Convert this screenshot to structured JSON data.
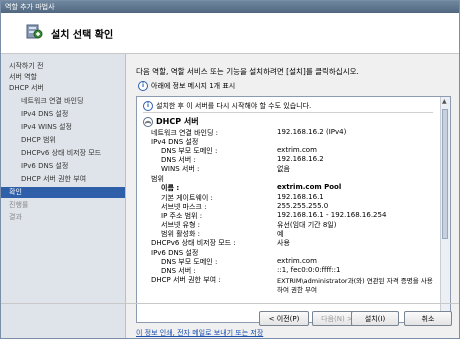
{
  "window": {
    "title": "역할 추가 마법사"
  },
  "header": {
    "title": "설치 선택 확인"
  },
  "sidebar": {
    "items": [
      {
        "label": "시작하기 전"
      },
      {
        "label": "서버 역할"
      },
      {
        "label": "DHCP 서버"
      },
      {
        "label": "네트워크 연결 바인딩"
      },
      {
        "label": "IPv4 DNS 설정"
      },
      {
        "label": "IPv4 WINS 설정"
      },
      {
        "label": "DHCP 범위"
      },
      {
        "label": "DHCPv6 상태 비저장 모드"
      },
      {
        "label": "IPv6 DNS 설정"
      },
      {
        "label": "DHCP 서버 권한 부여"
      },
      {
        "label": "확인"
      },
      {
        "label": "진행률"
      },
      {
        "label": "결과"
      }
    ]
  },
  "main": {
    "intro": "다음 역할, 역할 서비스 또는 기능을 설치하려면 [설치]를 클릭하십시오.",
    "info_link": "아래에 정보 메시지 1개 표시",
    "warning": "설치한 후 이 서버를 다시 시작해야 할 수도 있습니다.",
    "section_title": "DHCP 서버",
    "rows": [
      {
        "label": "네트워크 연결 바인딩 :",
        "value": "192.168.16.2 (IPv4)"
      },
      {
        "label": "IPv4 DNS 설정",
        "value": ""
      },
      {
        "label": "DNS 부모 도메인 :",
        "value": "extrim.com"
      },
      {
        "label": "DNS 서버 :",
        "value": "192.168.16.2"
      },
      {
        "label": "WINS 서버 :",
        "value": "없음"
      },
      {
        "label": "범위",
        "value": ""
      },
      {
        "label": "이름 :",
        "value": "extrim.com Pool"
      },
      {
        "label": "기본 게이트웨이 :",
        "value": "192.168.16.1"
      },
      {
        "label": "서브넷 마스크 :",
        "value": "255.255.255.0"
      },
      {
        "label": "IP 주소 범위 :",
        "value": "192.168.16.1 - 192.168.16.254"
      },
      {
        "label": "서브넷 유형 :",
        "value": "유선(임대 기간 8일)"
      },
      {
        "label": "범위 활성화 :",
        "value": "예"
      },
      {
        "label": "DHCPv6 상태 비저장 모드 :",
        "value": "사용"
      },
      {
        "label": "IPv6 DNS 설정",
        "value": ""
      },
      {
        "label": "DNS 부모 도메인 :",
        "value": "extrim.com"
      },
      {
        "label": "DNS 서버 :",
        "value": "::1, fec0:0:0:ffff::1"
      },
      {
        "label": "DHCP 서버 권한 부여 :",
        "value": "EXTRIM\\administrator과(와) 연관된 자격 증명을 사용"
      },
      {
        "label": "",
        "value": "하여 권한 부여"
      }
    ],
    "bottom_link": "이 정보 인쇄, 전자 메일로 보내기 또는 저장"
  },
  "buttons": {
    "prev": "< 이전(P)",
    "next": "다음(N) >",
    "install": "설치(I)",
    "cancel": "취소"
  }
}
